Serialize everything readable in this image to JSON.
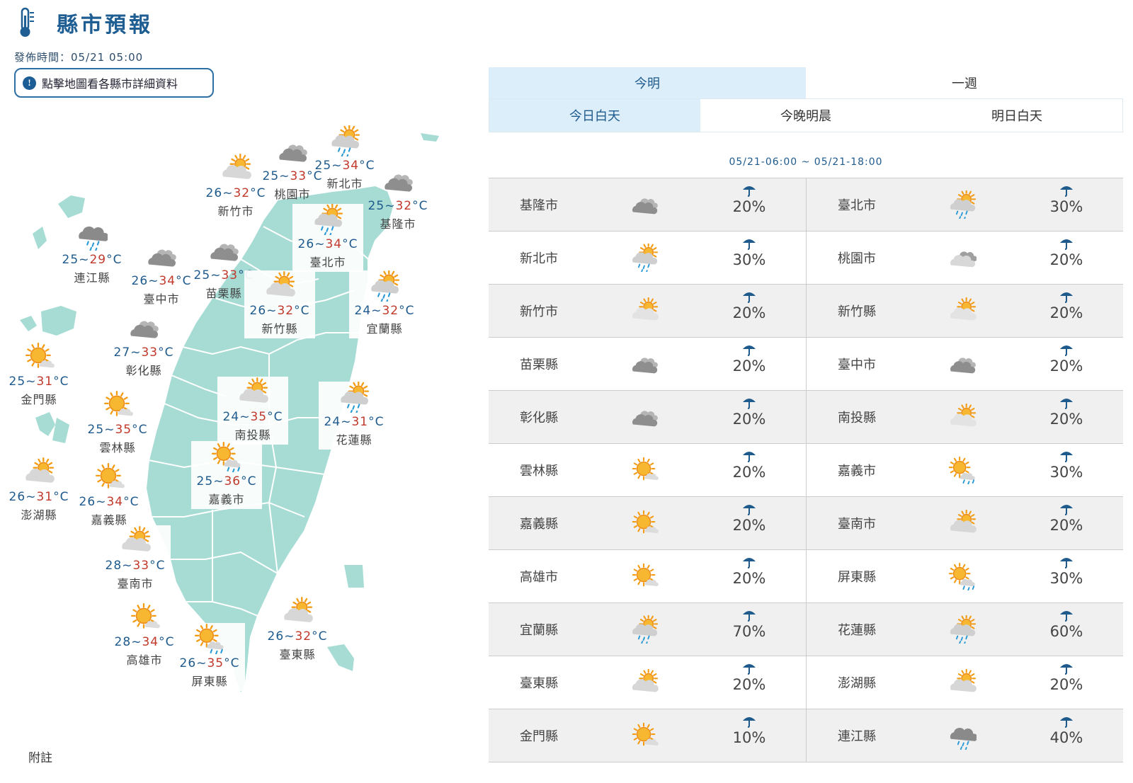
{
  "header": {
    "title": "縣市預報",
    "publish_time": "發佈時間：05/21 05:00",
    "hint": "點擊地圖看各縣市詳細資料"
  },
  "map_labels": [
    {
      "name": "連江縣",
      "lo": "25",
      "hi": "29",
      "icon": "cloud-rain"
    },
    {
      "name": "金門縣",
      "lo": "25",
      "hi": "31",
      "icon": "sunny"
    },
    {
      "name": "澎湖縣",
      "lo": "26",
      "hi": "31",
      "icon": "cloud-sun"
    },
    {
      "name": "新竹市",
      "lo": "26",
      "hi": "32",
      "icon": "cloud-sun"
    },
    {
      "name": "桃園市",
      "lo": "25",
      "hi": "33",
      "icon": "cloudy"
    },
    {
      "name": "新北市",
      "lo": "25",
      "hi": "34",
      "icon": "sun-rain"
    },
    {
      "name": "基隆市",
      "lo": "25",
      "hi": "32",
      "icon": "cloudy"
    },
    {
      "name": "臺北市",
      "lo": "26",
      "hi": "34",
      "icon": "sun-rain"
    },
    {
      "name": "臺中市",
      "lo": "26",
      "hi": "34",
      "icon": "cloudy"
    },
    {
      "name": "苗栗縣",
      "lo": "25",
      "hi": "33",
      "icon": "cloudy"
    },
    {
      "name": "新竹縣",
      "lo": "26",
      "hi": "32",
      "icon": "cloud-sun"
    },
    {
      "name": "宜蘭縣",
      "lo": "24",
      "hi": "32",
      "icon": "sun-rain"
    },
    {
      "name": "彰化縣",
      "lo": "27",
      "hi": "33",
      "icon": "cloudy"
    },
    {
      "name": "雲林縣",
      "lo": "25",
      "hi": "35",
      "icon": "sunny"
    },
    {
      "name": "南投縣",
      "lo": "24",
      "hi": "35",
      "icon": "cloud-sun"
    },
    {
      "name": "花蓮縣",
      "lo": "24",
      "hi": "31",
      "icon": "sun-rain"
    },
    {
      "name": "嘉義市",
      "lo": "25",
      "hi": "36",
      "icon": "sun-cloud-rain"
    },
    {
      "name": "嘉義縣",
      "lo": "26",
      "hi": "34",
      "icon": "sunny"
    },
    {
      "name": "臺南市",
      "lo": "28",
      "hi": "33",
      "icon": "cloud-sun"
    },
    {
      "name": "臺東縣",
      "lo": "26",
      "hi": "32",
      "icon": "cloud-sun"
    },
    {
      "name": "高雄市",
      "lo": "28",
      "hi": "34",
      "icon": "sunny"
    },
    {
      "name": "屏東縣",
      "lo": "26",
      "hi": "35",
      "icon": "sun-cloud-rain"
    }
  ],
  "tabs": {
    "top": [
      "今明",
      "一週"
    ],
    "sub": [
      "今日白天",
      "今晚明晨",
      "明日白天"
    ]
  },
  "period": "05/21-06:00 ~ 05/21-18:00",
  "forecast_rows": [
    [
      {
        "name": "基隆市",
        "icon": "cloudy-dark",
        "pop": "20%"
      },
      {
        "name": "臺北市",
        "icon": "sun-rain",
        "pop": "30%"
      }
    ],
    [
      {
        "name": "新北市",
        "icon": "sun-rain",
        "pop": "30%"
      },
      {
        "name": "桃園市",
        "icon": "cloudy-light",
        "pop": "20%"
      }
    ],
    [
      {
        "name": "新竹市",
        "icon": "cloud-sun-light",
        "pop": "20%"
      },
      {
        "name": "新竹縣",
        "icon": "cloud-sun-light",
        "pop": "20%"
      }
    ],
    [
      {
        "name": "苗栗縣",
        "icon": "cloudy-dark",
        "pop": "20%"
      },
      {
        "name": "臺中市",
        "icon": "cloudy-dark",
        "pop": "20%"
      }
    ],
    [
      {
        "name": "彰化縣",
        "icon": "cloudy-dark",
        "pop": "20%"
      },
      {
        "name": "南投縣",
        "icon": "cloud-sun-light",
        "pop": "20%"
      }
    ],
    [
      {
        "name": "雲林縣",
        "icon": "sunny",
        "pop": "20%"
      },
      {
        "name": "嘉義市",
        "icon": "sun-cloud-rain",
        "pop": "30%"
      }
    ],
    [
      {
        "name": "嘉義縣",
        "icon": "sunny",
        "pop": "20%"
      },
      {
        "name": "臺南市",
        "icon": "cloud-sun",
        "pop": "20%"
      }
    ],
    [
      {
        "name": "高雄市",
        "icon": "sunny",
        "pop": "20%"
      },
      {
        "name": "屏東縣",
        "icon": "sun-cloud-rain",
        "pop": "30%"
      }
    ],
    [
      {
        "name": "宜蘭縣",
        "icon": "sun-rain",
        "pop": "70%"
      },
      {
        "name": "花蓮縣",
        "icon": "sun-rain",
        "pop": "60%"
      }
    ],
    [
      {
        "name": "臺東縣",
        "icon": "cloud-sun",
        "pop": "20%"
      },
      {
        "name": "澎湖縣",
        "icon": "cloud-sun",
        "pop": "20%"
      }
    ],
    [
      {
        "name": "金門縣",
        "icon": "sunny",
        "pop": "10%"
      },
      {
        "name": "連江縣",
        "icon": "cloud-rain",
        "pop": "40%"
      }
    ]
  ],
  "notes_label": "附註",
  "colors": {
    "accent": "#1e5a8c",
    "hi_temp": "#c0392b",
    "map_fill": "#a7dcd5",
    "tab_active": "#ddeefb"
  }
}
